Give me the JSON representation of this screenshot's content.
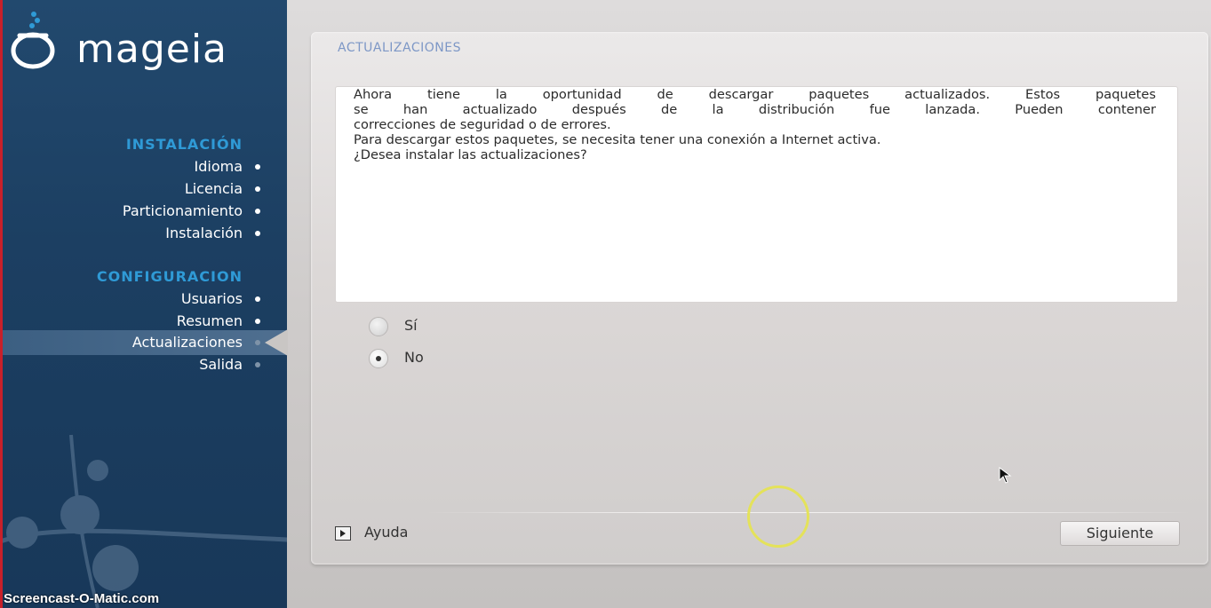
{
  "brand": {
    "name": "mageia"
  },
  "sidebar": {
    "sections": [
      {
        "title": "INSTALACIÓN",
        "items": [
          "Idioma",
          "Licencia",
          "Particionamiento",
          "Instalación"
        ]
      },
      {
        "title": "CONFIGURACION",
        "items": [
          "Usuarios",
          "Resumen",
          "Actualizaciones",
          "Salida"
        ]
      }
    ],
    "active_item": "Actualizaciones"
  },
  "panel": {
    "title": "ACTUALIZACIONES",
    "message": {
      "line1": "Ahora tiene la oportunidad de descargar paquetes actualizados. Estos paquetes",
      "line2": "se han actualizado después de la distribución fue lanzada. Pueden contener",
      "line3": "correcciones de seguridad o de errores.",
      "line4": "Para descargar estos paquetes, se necesita tener una conexión a Internet activa.",
      "line5": "¿Desea instalar las actualizaciones?"
    },
    "options": [
      {
        "label": "Sí",
        "selected": false
      },
      {
        "label": "No",
        "selected": true
      }
    ]
  },
  "footer": {
    "help_label": "Ayuda",
    "next_label": "Siguiente"
  },
  "watermark": "Screencast-O-Matic.com",
  "colors": {
    "sidebar_bg": "#1c3f62",
    "section_title": "#2f9ad6",
    "panel_title": "#7d97c6",
    "cursor_ring": "#e4e25a"
  }
}
